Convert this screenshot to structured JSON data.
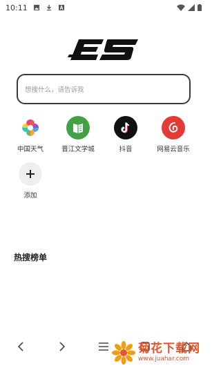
{
  "status_bar": {
    "time": "10:11"
  },
  "search": {
    "placeholder": "想搜什么，请告诉我"
  },
  "shortcuts": [
    {
      "label": "中国天气"
    },
    {
      "label": "晋江文学城"
    },
    {
      "label": "抖音"
    },
    {
      "label": "网易云音乐"
    },
    {
      "label": "添加"
    }
  ],
  "section": {
    "title": "热搜榜单"
  },
  "watermark": {
    "name": "菊花下载网",
    "url": "www.juahar.com"
  },
  "colors": {
    "jinjiang_green": "#43a047",
    "netease_red": "#e53935",
    "tiktok_black": "#111111",
    "watermark_orange": "#e4532a"
  },
  "icons": [
    "image-icon",
    "download-icon",
    "a-icon",
    "wifi-icon",
    "signal-icon",
    "battery-icon",
    "back-icon",
    "forward-icon",
    "menu-icon",
    "tabs-icon",
    "home-icon"
  ]
}
